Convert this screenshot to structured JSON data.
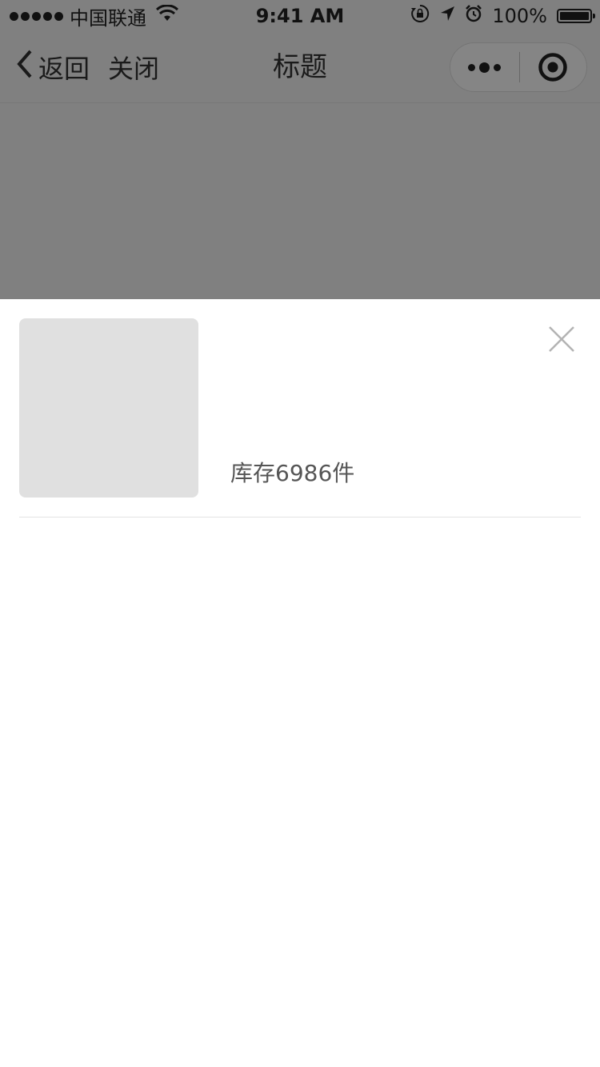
{
  "status_bar": {
    "carrier": "中国联通",
    "time": "9:41 AM",
    "battery": "100%",
    "battery_level": 1.0,
    "icons": [
      "signal-dots-icon",
      "wifi-icon",
      "orientation-lock-icon",
      "location-arrow-icon",
      "alarm-icon",
      "battery-icon"
    ]
  },
  "nav": {
    "back_label": "返回",
    "close_label": "关闭",
    "title": "标题",
    "more_icon": "more-dots-icon",
    "target_icon": "target-icon"
  },
  "sheet": {
    "stock_label": "库存6986件",
    "close_icon": "close-icon"
  },
  "colors": {
    "overlay": "#808080",
    "sheet_background": "#ffffff",
    "thumbnail_placeholder": "#e0e0e0",
    "stock_text": "#555555",
    "close_icon": "#b3b3b3"
  }
}
